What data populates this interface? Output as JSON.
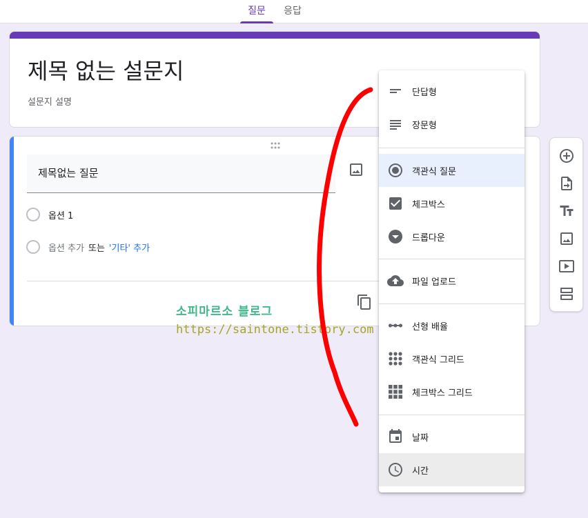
{
  "tabs": [
    {
      "label": "질문",
      "active": true
    },
    {
      "label": "응답",
      "active": false
    }
  ],
  "form": {
    "title": "제목 없는 설문지",
    "description": "설문지 설명"
  },
  "question": {
    "title": "제목없는 질문",
    "options": [
      "옵션 1"
    ],
    "add_option": "옵션 추가",
    "or_text": "또는",
    "add_other": "'기타' 추가"
  },
  "watermark": {
    "line1": "소피마르소 블로그",
    "line2": "https://saintone.tistory.com"
  },
  "side_toolbar": {
    "icons": [
      "add-circle-icon",
      "import-icon",
      "title-text-icon",
      "image-icon",
      "video-icon",
      "section-icon"
    ]
  },
  "menu": {
    "items": [
      {
        "label": "단답형",
        "icon": "short-answer-icon"
      },
      {
        "label": "장문형",
        "icon": "paragraph-icon"
      },
      {
        "label": "객관식 질문",
        "icon": "radio-icon",
        "selected": true
      },
      {
        "label": "체크박스",
        "icon": "checkbox-icon"
      },
      {
        "label": "드롭다운",
        "icon": "dropdown-icon"
      },
      {
        "label": "파일 업로드",
        "icon": "cloud-upload-icon"
      },
      {
        "label": "선형 배율",
        "icon": "linear-scale-icon"
      },
      {
        "label": "객관식 그리드",
        "icon": "radio-grid-icon"
      },
      {
        "label": "체크박스 그리드",
        "icon": "checkbox-grid-icon"
      },
      {
        "label": "날짜",
        "icon": "calendar-icon"
      },
      {
        "label": "시간",
        "icon": "clock-icon",
        "hover": true
      }
    ]
  },
  "colors": {
    "accent": "#673ab7",
    "question_bar": "#4285f4",
    "background": "#efebf8",
    "annotation": "#ff0000"
  }
}
